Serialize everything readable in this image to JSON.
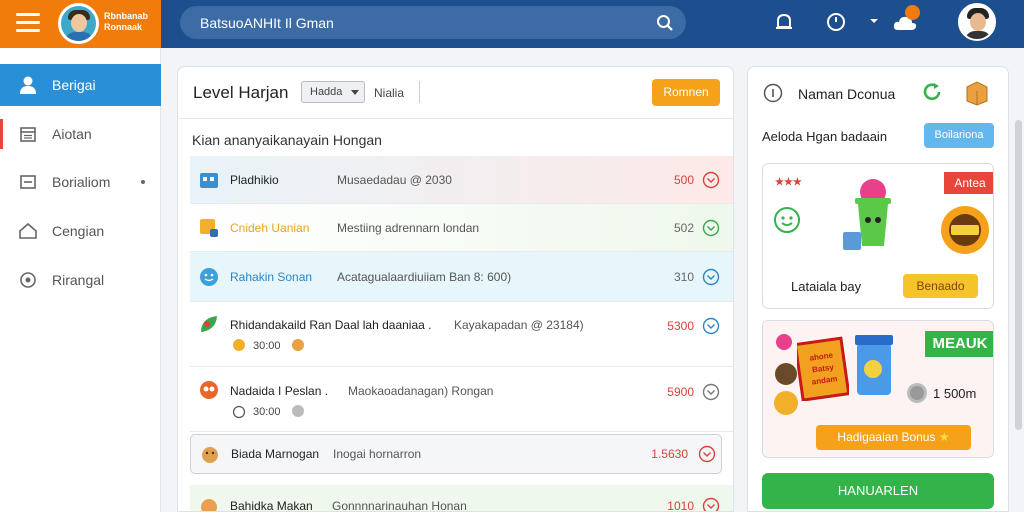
{
  "brand": {
    "name_line1": "Rbnbanab",
    "name_line2": "Ronnaak"
  },
  "search": {
    "text": "BatsuoANHIt Il Gman"
  },
  "sidebar": {
    "items": [
      {
        "label": "Berigai",
        "icon": "user-icon"
      },
      {
        "label": "Aiotan",
        "icon": "calendar-icon"
      },
      {
        "label": "Borialiom",
        "icon": "card-icon"
      },
      {
        "label": "Cengian",
        "icon": "home-icon"
      },
      {
        "label": "Rirangal",
        "icon": "target-icon"
      }
    ]
  },
  "main": {
    "title": "Level Harjan",
    "dropdown": "Hadda",
    "sort_label": "Nialia",
    "button": "Romnen",
    "subtitle": "Kian ananyaikanayain Hongan",
    "rows": [
      {
        "name": "Pladhikio",
        "desc": "Musaedadau @ 2030",
        "points": "500",
        "color": "#d8423a"
      },
      {
        "name": "Cnideh Uanian",
        "desc": "Mestiing adrennarn londan",
        "points": "502",
        "color": "#666666"
      },
      {
        "name": "Rahakin Sonan",
        "desc": "Acatagualaardiuiiam Ban 8: 600)",
        "points": "310",
        "color": "#666666"
      },
      {
        "name": "Rhidandakaild Ran Daal lah daaniaa .",
        "desc": "Kayakapadan @ 23184)",
        "sub": "30:00",
        "points": "5300",
        "color": "#d8423a"
      },
      {
        "name": "Nadaida I Peslan .",
        "desc": "Maokaoadanagan) Rongan",
        "sub": "30:00",
        "points": "5900",
        "color": "#d8423a"
      },
      {
        "name": "Biada Marnogan",
        "desc": "Inogai hornarron",
        "points": "1.5630",
        "color": "#d8423a"
      },
      {
        "name": "Bahidka Makan",
        "desc": "Gonnnnarinauhan Honan",
        "points": "1010",
        "color": "#d8423a"
      }
    ]
  },
  "right": {
    "title": "Naman Dconua",
    "subtitle": "Aeloda Hgan badaain",
    "button": "Boilariona",
    "card1": {
      "ribbon": "Antea",
      "label": "Lataiala bay",
      "button": "Benaado"
    },
    "card2": {
      "ribbon": "MEAUK",
      "stat": "1 500m",
      "button": "Hadigaaian Bonus",
      "sign": "ahone Batsy andam"
    },
    "green_button": "HANUARLEN"
  }
}
